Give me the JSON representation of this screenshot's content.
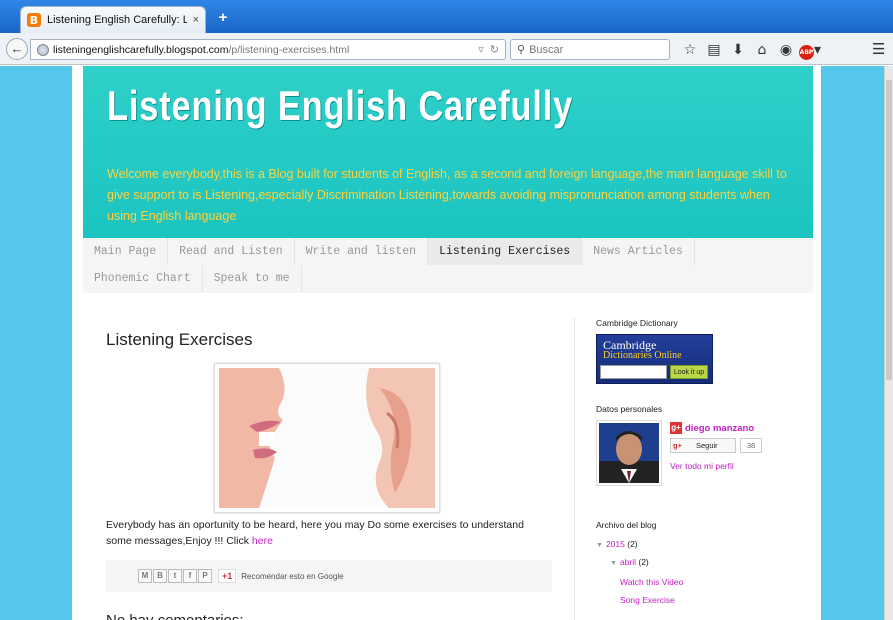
{
  "browser": {
    "tab_title": "Listening English Carefully: Lis...",
    "tab_close": "×",
    "new_tab": "+",
    "favicon_letter": "B",
    "url_host": "listeningenglishcarefully.blogspot.com",
    "url_path": "/p/listening-exercises.html",
    "search_placeholder": "Buscar",
    "abp_label": "ABP"
  },
  "blog": {
    "title": "Listening English Carefully",
    "description": "Welcome everybody,this is a Blog built for students of English, as a second and foreign language,the main language skill to give support to is Listening,especially Discrimination Listening,towards avoiding mispronunciation among students when using English language",
    "colors": {
      "header": "#1bc4c0",
      "description": "#ffd23a",
      "link": "#c320c6",
      "background": "#56c7ec"
    }
  },
  "nav": {
    "row1": [
      "Main Page",
      "Read and Listen",
      "Write and listen",
      "Listening Exercises",
      "News Articles"
    ],
    "row2": [
      "Phonemic Chart",
      "Speak to me"
    ],
    "active": "Listening Exercises"
  },
  "post": {
    "title": "Listening Exercises",
    "body": "Everybody has an oportunity to be heard, here you may Do some exercises to understand some messages,Enjoy !!! Click ",
    "link_text": "here",
    "share_gplus": "+1",
    "share_text": "Recomendar esto en Google",
    "comments_title": "No hay comentarios:"
  },
  "sidebar": {
    "dictionary": {
      "title": "Cambridge Dictionary",
      "brand1": "Cambridge",
      "brand2": "Dictionaries Online",
      "button": "Look it up"
    },
    "profile": {
      "title": "Datos personales",
      "name": "diego manzano",
      "follow": "Seguir",
      "follow_count": "38",
      "link": "Ver todo mi perfil"
    },
    "archive": {
      "title": "Archivo del blog",
      "year": "2015",
      "year_count": "(2)",
      "month": "abril",
      "month_count": "(2)",
      "posts": [
        "Watch this Video",
        "Song Exercise"
      ]
    }
  }
}
